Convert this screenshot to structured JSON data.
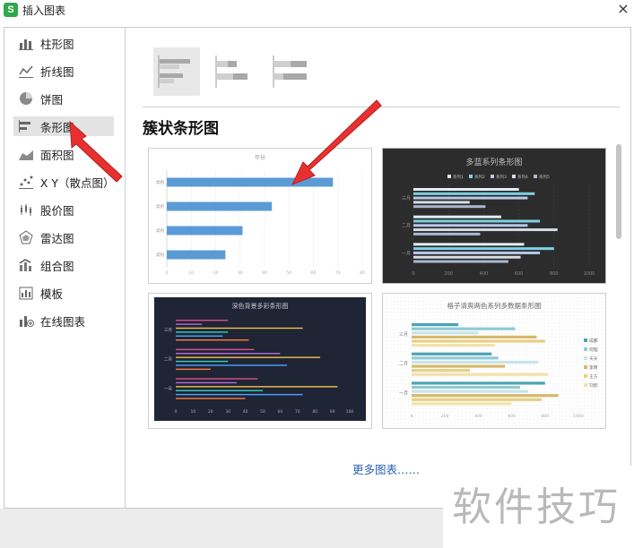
{
  "window": {
    "title": "插入图表",
    "app_icon_letter": "S",
    "close_glyph": "×"
  },
  "sidebar": {
    "items": [
      {
        "label": "柱形图",
        "icon": "column-chart-icon"
      },
      {
        "label": "折线图",
        "icon": "line-chart-icon"
      },
      {
        "label": "饼图",
        "icon": "pie-chart-icon"
      },
      {
        "label": "条形图",
        "icon": "bar-chart-icon",
        "selected": true
      },
      {
        "label": "面积图",
        "icon": "area-chart-icon"
      },
      {
        "label": "X Y（散点图）",
        "icon": "scatter-chart-icon"
      },
      {
        "label": "股价图",
        "icon": "stock-chart-icon"
      },
      {
        "label": "雷达图",
        "icon": "radar-chart-icon"
      },
      {
        "label": "组合图",
        "icon": "combo-chart-icon"
      },
      {
        "label": "模板",
        "icon": "template-icon"
      },
      {
        "label": "在线图表",
        "icon": "online-chart-icon"
      }
    ]
  },
  "subtypes": [
    {
      "name": "clustered-bar",
      "selected": true
    },
    {
      "name": "stacked-bar"
    },
    {
      "name": "percent-stacked-bar"
    }
  ],
  "section_title": "簇状条形图",
  "thumbnails": {
    "t1": {
      "title": "年份",
      "categories": [
        "类别",
        "类别",
        "类别",
        "类别"
      ],
      "values": [
        68,
        43,
        31,
        24
      ],
      "ticks": [
        "0",
        "10",
        "20",
        "30",
        "40",
        "50",
        "60",
        "70",
        "80"
      ],
      "bar_color": "#5b9bd5"
    },
    "t2": {
      "title": "多蓝系列条形图",
      "legend": [
        "系列1",
        "系列2",
        "系列3",
        "系列4",
        "系列5"
      ],
      "categories": [
        "三月",
        "二月",
        "一月"
      ],
      "ticks": [
        "0",
        "200",
        "400",
        "600",
        "800",
        "1000"
      ],
      "colors": [
        "#e3eef8",
        "#7fd1e6",
        "#b8c9ea",
        "#d7dde6",
        "#aab8d0"
      ]
    },
    "t3": {
      "title": "深色背景多彩条形图",
      "categories": [
        "三月",
        "二月",
        "一月"
      ],
      "ticks": [
        "0",
        "10",
        "20",
        "30",
        "40",
        "50",
        "60",
        "70",
        "80",
        "90",
        "100"
      ],
      "colors": [
        "#e04e8c",
        "#b86bd6",
        "#f2c14e",
        "#2fd1c5",
        "#4aa3ff",
        "#ff7a3d"
      ]
    },
    "t4": {
      "title": "格子清爽两色系列多数据条形图",
      "categories": [
        "三月",
        "二月",
        "一月"
      ],
      "ticks": [
        "0",
        "200",
        "400",
        "600",
        "800",
        "1000"
      ],
      "legend": [
        "成都",
        "何理",
        "天天",
        "李商",
        "王方",
        "刘欣"
      ],
      "colors": [
        "#4ea3b2",
        "#8fc9d4",
        "#c9e4e9",
        "#d6b86a",
        "#e8cf82",
        "#f2e2ab"
      ]
    }
  },
  "more_charts_link": "更多图表……",
  "watermark": "软件技巧"
}
